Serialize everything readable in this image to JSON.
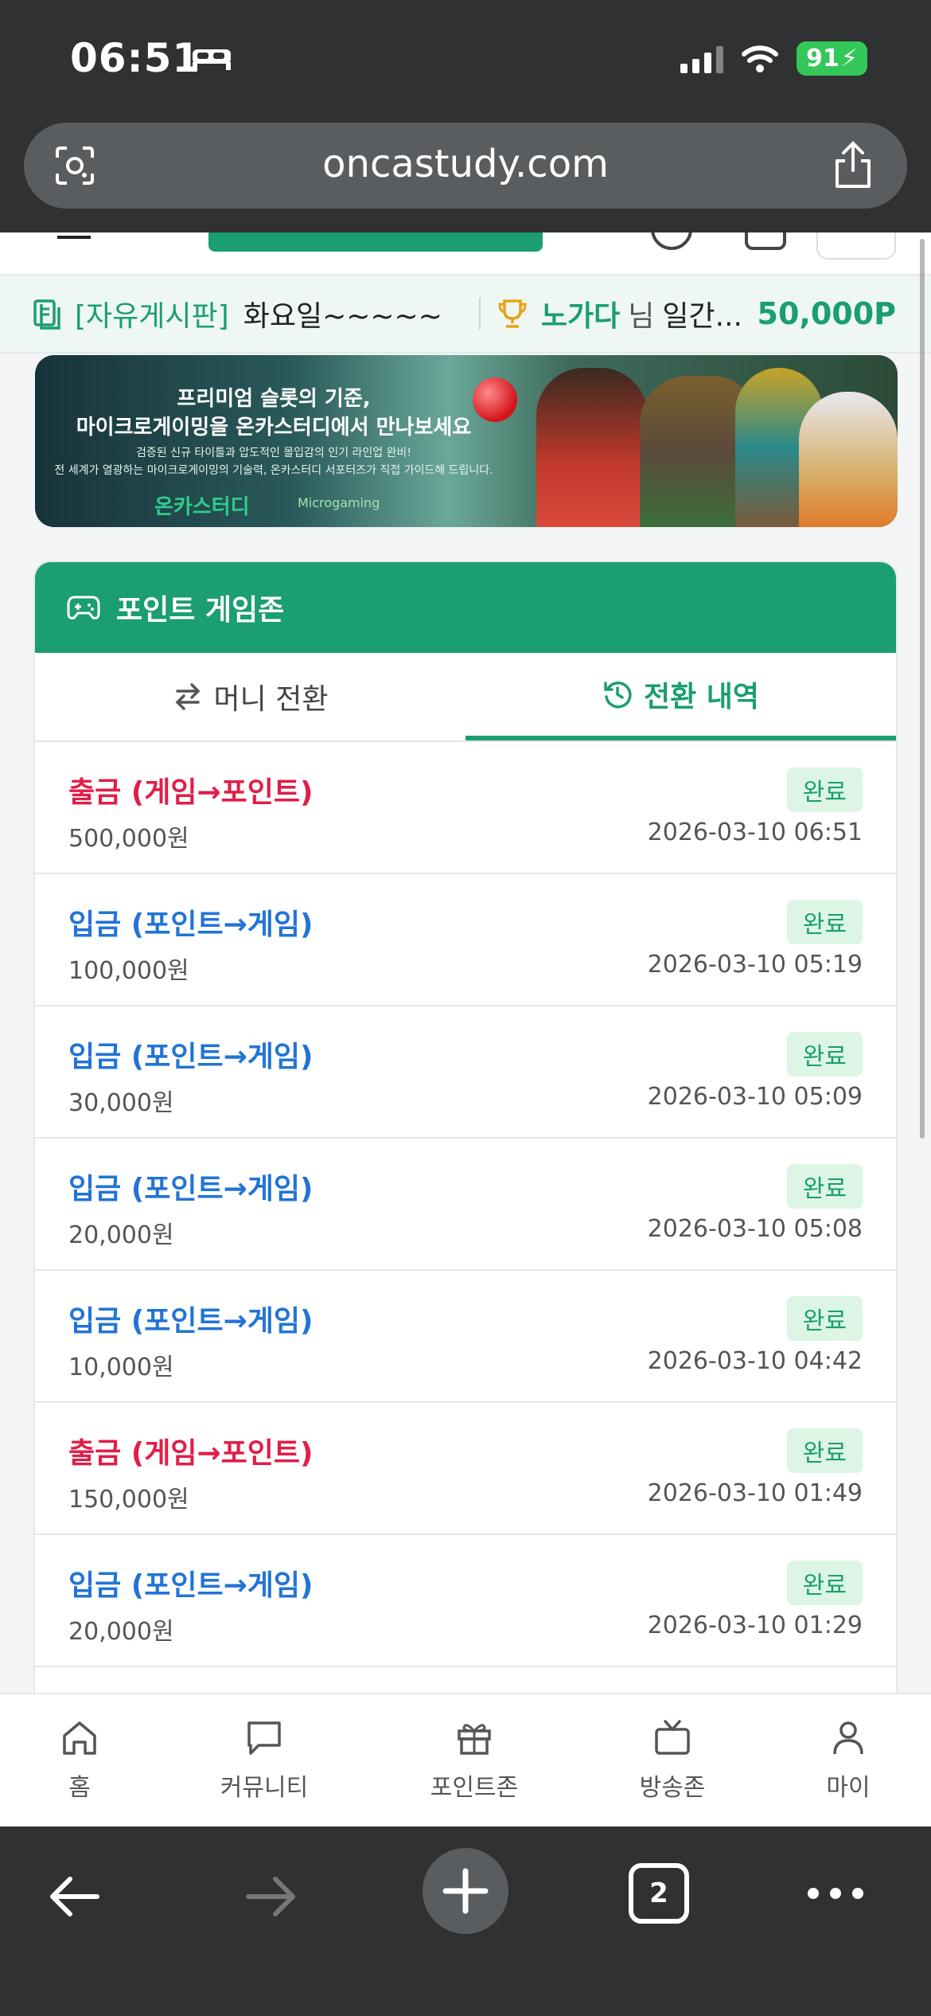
{
  "status_bar": {
    "time": "06:51",
    "battery": "91"
  },
  "browser": {
    "url": "oncastudy.com",
    "tab_count": "2"
  },
  "ticker": {
    "board": "[자유게시판]",
    "post": "화요일~~~~~",
    "user": "노가다",
    "honorific": "님",
    "rank_text": "일간...",
    "points": "50,000P"
  },
  "banner": {
    "title_line1": "프리미엄 슬롯의 기준,",
    "title_line2": "마이크로게이밍을 온카스터디에서 만나보세요",
    "sub_line1": "검증된 신규 타이틀과 압도적인 몰입감의 인기 라인업 완비!",
    "sub_line2": "전 세계가 열광하는 마이크로게이밍의 기술력, 온카스터디 서포터즈가 직접 가이드해 드립니다.",
    "logo": "온카스터디",
    "partner": "Microgaming"
  },
  "game_zone": {
    "title": "포인트 게임존",
    "tabs": [
      {
        "label": "머니 전환",
        "active": false
      },
      {
        "label": "전환 내역",
        "active": true
      }
    ],
    "transactions": [
      {
        "type": "출금 (게임→포인트)",
        "direction": "out",
        "amount": "500,000원",
        "status": "완료",
        "time": "2026-03-10 06:51"
      },
      {
        "type": "입금 (포인트→게임)",
        "direction": "in",
        "amount": "100,000원",
        "status": "완료",
        "time": "2026-03-10 05:19"
      },
      {
        "type": "입금 (포인트→게임)",
        "direction": "in",
        "amount": "30,000원",
        "status": "완료",
        "time": "2026-03-10 05:09"
      },
      {
        "type": "입금 (포인트→게임)",
        "direction": "in",
        "amount": "20,000원",
        "status": "완료",
        "time": "2026-03-10 05:08"
      },
      {
        "type": "입금 (포인트→게임)",
        "direction": "in",
        "amount": "10,000원",
        "status": "완료",
        "time": "2026-03-10 04:42"
      },
      {
        "type": "출금 (게임→포인트)",
        "direction": "out",
        "amount": "150,000원",
        "status": "완료",
        "time": "2026-03-10 01:49"
      },
      {
        "type": "입금 (포인트→게임)",
        "direction": "in",
        "amount": "20,000원",
        "status": "완료",
        "time": "2026-03-10 01:29"
      }
    ]
  },
  "bottom_nav": [
    {
      "label": "홈",
      "icon": "home-icon"
    },
    {
      "label": "커뮤니티",
      "icon": "chat-icon"
    },
    {
      "label": "포인트존",
      "icon": "gift-icon"
    },
    {
      "label": "방송존",
      "icon": "tv-icon"
    },
    {
      "label": "마이",
      "icon": "user-icon"
    }
  ],
  "colors": {
    "brand": "#1a9e72",
    "withdraw": "#e11d48",
    "deposit": "#2274d6",
    "badge_bg": "#dcf5e4"
  }
}
